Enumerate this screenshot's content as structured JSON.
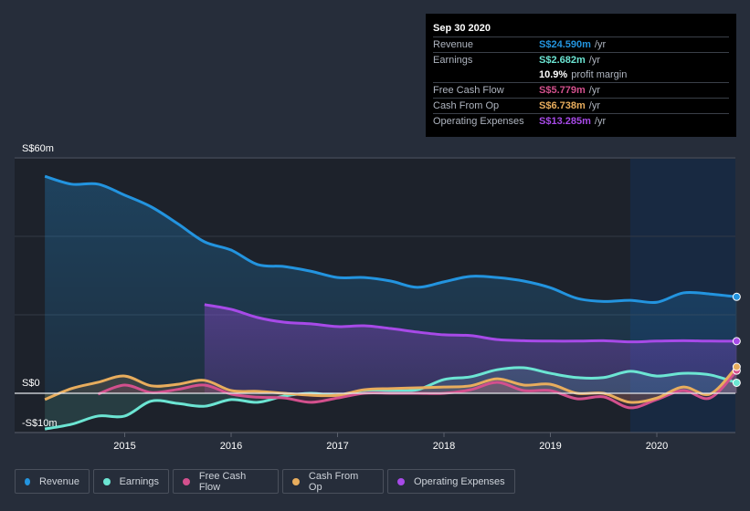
{
  "tooltip": {
    "date": "Sep 30 2020",
    "rows": [
      {
        "label": "Revenue",
        "value": "S$24.590m",
        "unit": "/yr",
        "color": "#2394df"
      },
      {
        "label": "Earnings",
        "value": "S$2.682m",
        "unit": "/yr",
        "color": "#6ce5d3"
      },
      {
        "label": "",
        "value": "10.9%",
        "unit": "profit margin",
        "color": "#ffffff"
      },
      {
        "label": "Free Cash Flow",
        "value": "S$5.779m",
        "unit": "/yr",
        "color": "#d3508d"
      },
      {
        "label": "Cash From Op",
        "value": "S$6.738m",
        "unit": "/yr",
        "color": "#e8ad5d"
      },
      {
        "label": "Operating Expenses",
        "value": "S$13.285m",
        "unit": "/yr",
        "color": "#a74ae8"
      }
    ]
  },
  "legend": [
    {
      "label": "Revenue",
      "color": "#2394df"
    },
    {
      "label": "Earnings",
      "color": "#6ce5d3"
    },
    {
      "label": "Free Cash Flow",
      "color": "#d3508d"
    },
    {
      "label": "Cash From Op",
      "color": "#e8ad5d"
    },
    {
      "label": "Operating Expenses",
      "color": "#a74ae8"
    }
  ],
  "chart_data": {
    "type": "area",
    "title": "",
    "xlabel": "",
    "ylabel": "",
    "currency": "S$",
    "unit": "m",
    "ylim": [
      -10,
      60
    ],
    "xlim": [
      2014.25,
      2020.75
    ],
    "y_tick_labels": [
      "S$60m",
      "S$0",
      "-S$10m"
    ],
    "y_ticks": [
      60,
      0,
      -10
    ],
    "gridlines": [
      60,
      40,
      20
    ],
    "x_ticks": [
      2015,
      2016,
      2017,
      2018,
      2019,
      2020
    ],
    "x_tick_labels": [
      "2015",
      "2016",
      "2017",
      "2018",
      "2019",
      "2020"
    ],
    "highlight_range": [
      2019.75,
      2020.75
    ],
    "legend_position": "bottom",
    "series": [
      {
        "name": "Revenue",
        "color": "#2394df",
        "fill": true,
        "x": [
          2014.25,
          2014.5,
          2014.75,
          2015.0,
          2015.25,
          2015.5,
          2015.75,
          2016.0,
          2016.25,
          2016.5,
          2016.75,
          2017.0,
          2017.25,
          2017.5,
          2017.75,
          2018.0,
          2018.25,
          2018.5,
          2018.75,
          2019.0,
          2019.25,
          2019.5,
          2019.75,
          2020.0,
          2020.25,
          2020.5,
          2020.75
        ],
        "values": [
          55.3,
          53.3,
          53.3,
          50.5,
          47.5,
          43.2,
          38.6,
          36.5,
          32.8,
          32.3,
          31.1,
          29.5,
          29.5,
          28.6,
          27.0,
          28.4,
          29.8,
          29.5,
          28.6,
          26.9,
          24.2,
          23.4,
          23.7,
          23.2,
          25.6,
          25.3,
          24.59
        ]
      },
      {
        "name": "Operating Expenses",
        "color": "#a74ae8",
        "fill": true,
        "x": [
          2015.75,
          2016.0,
          2016.25,
          2016.5,
          2016.75,
          2017.0,
          2017.25,
          2017.5,
          2017.75,
          2018.0,
          2018.25,
          2018.5,
          2018.75,
          2019.0,
          2019.25,
          2019.5,
          2019.75,
          2020.0,
          2020.25,
          2020.5,
          2020.75
        ],
        "values": [
          22.6,
          21.4,
          19.3,
          18.1,
          17.7,
          17.0,
          17.2,
          16.5,
          15.6,
          14.9,
          14.7,
          13.7,
          13.4,
          13.3,
          13.3,
          13.4,
          13.1,
          13.3,
          13.4,
          13.3,
          13.285
        ]
      },
      {
        "name": "Earnings",
        "color": "#6ce5d3",
        "fill": true,
        "x": [
          2014.25,
          2014.5,
          2014.75,
          2015.0,
          2015.25,
          2015.5,
          2015.75,
          2016.0,
          2016.25,
          2016.5,
          2016.75,
          2017.0,
          2017.25,
          2017.5,
          2017.75,
          2018.0,
          2018.25,
          2018.5,
          2018.75,
          2019.0,
          2019.25,
          2019.5,
          2019.75,
          2020.0,
          2020.25,
          2020.5,
          2020.75
        ],
        "values": [
          -9.1,
          -7.9,
          -5.8,
          -5.8,
          -2.0,
          -2.6,
          -3.3,
          -1.6,
          -2.3,
          -0.7,
          0.0,
          -0.5,
          0.7,
          0.7,
          0.9,
          3.5,
          4.2,
          6.0,
          6.5,
          5.1,
          4.0,
          4.0,
          5.6,
          4.4,
          5.1,
          4.7,
          2.682
        ]
      },
      {
        "name": "Free Cash Flow",
        "color": "#d3508d",
        "fill": true,
        "x": [
          2014.75,
          2015.0,
          2015.25,
          2015.5,
          2015.75,
          2016.0,
          2016.25,
          2016.5,
          2016.75,
          2017.0,
          2017.25,
          2017.5,
          2017.75,
          2018.0,
          2018.25,
          2018.5,
          2018.75,
          2019.0,
          2019.25,
          2019.5,
          2019.75,
          2020.0,
          2020.25,
          2020.5,
          2020.75
        ],
        "values": [
          -0.2,
          2.1,
          0.2,
          1.0,
          2.1,
          -0.2,
          -1.0,
          -1.2,
          -2.3,
          -1.2,
          0.0,
          0.0,
          0.0,
          0.0,
          0.9,
          2.8,
          0.7,
          0.7,
          -1.4,
          -0.9,
          -3.7,
          -1.6,
          0.7,
          -1.2,
          5.779
        ]
      },
      {
        "name": "Cash From Op",
        "color": "#e8ad5d",
        "fill": true,
        "x": [
          2014.25,
          2014.5,
          2014.75,
          2015.0,
          2015.25,
          2015.5,
          2015.75,
          2016.0,
          2016.25,
          2016.5,
          2016.75,
          2017.0,
          2017.25,
          2017.5,
          2017.75,
          2018.0,
          2018.25,
          2018.5,
          2018.75,
          2019.0,
          2019.25,
          2019.5,
          2019.75,
          2020.0,
          2020.25,
          2020.5,
          2020.75
        ],
        "values": [
          -1.6,
          1.2,
          2.8,
          4.4,
          1.9,
          2.3,
          3.3,
          0.7,
          0.5,
          0.0,
          -0.5,
          -0.5,
          0.9,
          1.2,
          1.4,
          1.6,
          1.9,
          3.7,
          2.1,
          2.3,
          0.0,
          0.0,
          -2.3,
          -1.2,
          1.6,
          -0.2,
          6.738
        ]
      }
    ]
  }
}
